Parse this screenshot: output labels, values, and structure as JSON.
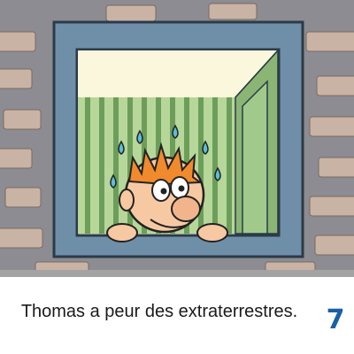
{
  "caption": "Thomas a peur des extraterrestres.",
  "page_number": "7",
  "colors": {
    "wall": "#8c8c92",
    "brick": "#c9b3a4",
    "frame": "#6f8fa9",
    "wallpaper_light": "#b7d69a",
    "wallpaper_dark": "#6c9e5a",
    "ceiling": "#fbf7dc",
    "skin": "#f7c9a3",
    "hair": "#f08a2c",
    "sweat": "#5bbfd8",
    "page_number": "#1a5fa8"
  },
  "icons": [
    "startled-boy",
    "sweat-drops"
  ]
}
